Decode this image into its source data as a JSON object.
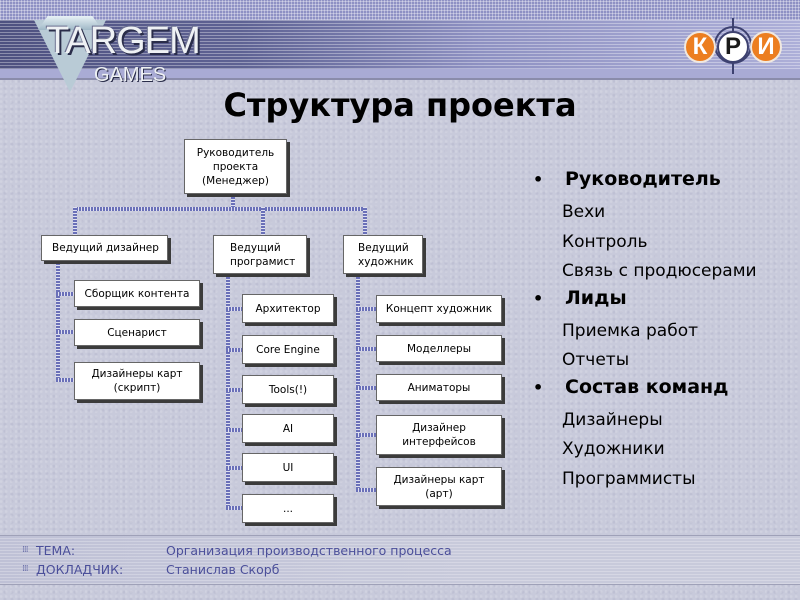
{
  "header": {
    "logo_left": {
      "name": "TARGEM",
      "sub": "GAMES"
    },
    "logo_right": {
      "letters": [
        "К",
        "Р",
        "И"
      ]
    },
    "colors": {
      "band_dark": "#4e5180",
      "band_light": "#adafd8",
      "kri_orange": "#ec7e20"
    }
  },
  "slide": {
    "title": "Структура проекта"
  },
  "org_chart": {
    "root": {
      "label": "Руководитель\nпроекта\n(Менеджер)"
    },
    "branches": [
      {
        "label": "Ведущий дизайнер",
        "children": [
          "Сборщик контента",
          "Сценарист",
          "Дизайнеры карт\n(скрипт)"
        ]
      },
      {
        "label": "Ведущий\nпрограмист",
        "children": [
          "Архитектор",
          "Core Engine",
          "Tools(!)",
          "AI",
          "UI",
          "..."
        ]
      },
      {
        "label": "Ведущий\nхудожник",
        "children": [
          "Концепт художник",
          "Моделлеры",
          "Аниматоры",
          "Дизайнер\nинтерфейсов",
          "Дизайнеры карт\n(арт)"
        ]
      }
    ]
  },
  "bullets": [
    {
      "title": "Руководитель",
      "items": [
        "Вехи",
        "Контроль",
        "Связь с продюсерами"
      ]
    },
    {
      "title": "Лиды",
      "items": [
        "Приемка работ",
        "Отчеты"
      ]
    },
    {
      "title": "Состав команд",
      "items": [
        "Дизайнеры",
        "Художники",
        "Программисты"
      ]
    }
  ],
  "footer": {
    "rows": [
      {
        "icon": "grid-dots-icon",
        "label": "ТЕМА:",
        "value": "Организация производственного процесса"
      },
      {
        "icon": "grid-dots-icon",
        "label": "ДОКЛАДЧИК:",
        "value": "Станислав Скорб"
      }
    ],
    "text_color": "#4b4f9a"
  }
}
